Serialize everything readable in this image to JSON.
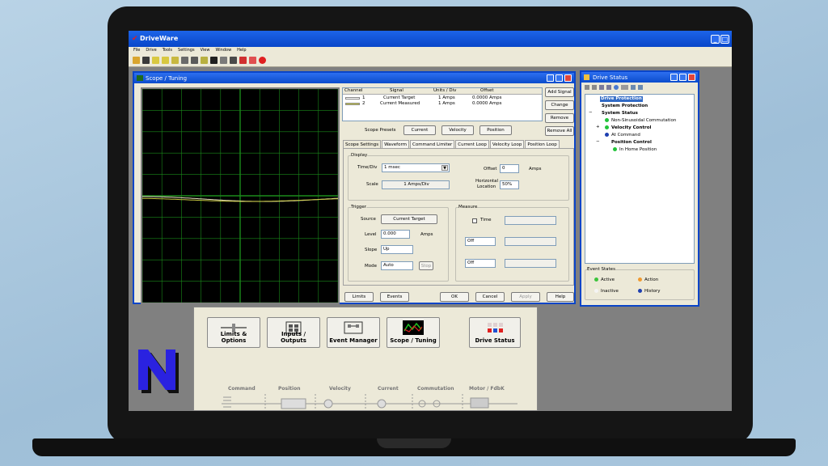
{
  "app": {
    "title": "DriveWare",
    "menu": [
      "File",
      "Drive",
      "Tools",
      "Settings",
      "View",
      "Window",
      "Help"
    ]
  },
  "scope_window": {
    "title": "Scope / Tuning",
    "channels": {
      "headers": [
        "Channel",
        "Signal",
        "Units / Div",
        "Offset"
      ],
      "rows": [
        {
          "channel": "1",
          "signal": "Current Target",
          "units": "1   Amps",
          "offset": "0.0000   Amps"
        },
        {
          "channel": "2",
          "signal": "Current Measured",
          "units": "1   Amps",
          "offset": "0.0000   Amps"
        }
      ]
    },
    "side_buttons": [
      "Add Signal",
      "Change",
      "Remove",
      "Remove All"
    ],
    "presets": {
      "label": "Scope Presets",
      "buttons": [
        "Current",
        "Velocity",
        "Position"
      ]
    },
    "tabs": [
      "Scope Settings",
      "Waveform",
      "Command Limiter",
      "Current Loop",
      "Velocity Loop",
      "Position Loop"
    ],
    "display": {
      "group_label": "Display",
      "time_div_label": "Time/Div",
      "time_div_value": "1 msec",
      "scale_label": "Scale",
      "scale_value": "1  Amps/Div",
      "offset_label": "Offset",
      "offset_value": "0",
      "offset_unit": "Amps",
      "horizontal_label": "Horizontal",
      "location_label": "Location",
      "horizontal_value": "50%"
    },
    "trigger": {
      "group_label": "Trigger",
      "source_label": "Source",
      "source_value": "Current Target",
      "level_label": "Level",
      "level_value": "0.000",
      "level_unit": "Amps",
      "slope_label": "Slope",
      "slope_value": "Up",
      "mode_label": "Mode",
      "mode_value": "Auto",
      "stop_label": "Stop"
    },
    "measure": {
      "group_label": "Measure",
      "time_label": "Time",
      "select1": "Off",
      "select2": "Off"
    },
    "bottom_buttons": [
      "Limits",
      "Events",
      "OK",
      "Cancel",
      "Apply",
      "Help"
    ]
  },
  "drive_status": {
    "title": "Drive Status",
    "tree": [
      {
        "label": "Drive Protection",
        "bold": true,
        "selected": true
      },
      {
        "label": "System Protection",
        "bold": true
      },
      {
        "label": "System Status",
        "bold": true
      },
      {
        "label": "Non-Sinusoidal Commutation",
        "color": "#22c43a"
      },
      {
        "label": "Velocity Control",
        "bold": true,
        "color": "#22c43a"
      },
      {
        "label": "At Command",
        "color": "#1e3fb0"
      },
      {
        "label": "Position Control",
        "bold": true
      },
      {
        "label": "In Home Position",
        "color": "#22c43a"
      }
    ],
    "event_states": {
      "label": "Event States",
      "items": [
        {
          "label": "Active",
          "color": "#3cc43c"
        },
        {
          "label": "Action",
          "color": "#f09a30"
        },
        {
          "label": "Inactive",
          "color": "#f4f4f4"
        },
        {
          "label": "History",
          "color": "#1e3fb0"
        }
      ]
    }
  },
  "launcher": {
    "buttons": [
      "Limits & Options",
      "Inputs / Outputs",
      "Event Manager",
      "Scope / Tuning",
      "Drive Status"
    ],
    "chain": [
      "Command",
      "Position",
      "Velocity",
      "Current",
      "Commutation",
      "Motor / FdbK"
    ]
  },
  "chart_data": {
    "type": "line",
    "series": [
      {
        "name": "Current Target",
        "color": "#e8e0c0"
      },
      {
        "name": "Current Measured",
        "color": "#c8c840"
      }
    ]
  },
  "colors": {
    "title_blue": "#0846c9",
    "scope_grid": "#1a8a1a",
    "n_logo": "#2a22e0"
  }
}
